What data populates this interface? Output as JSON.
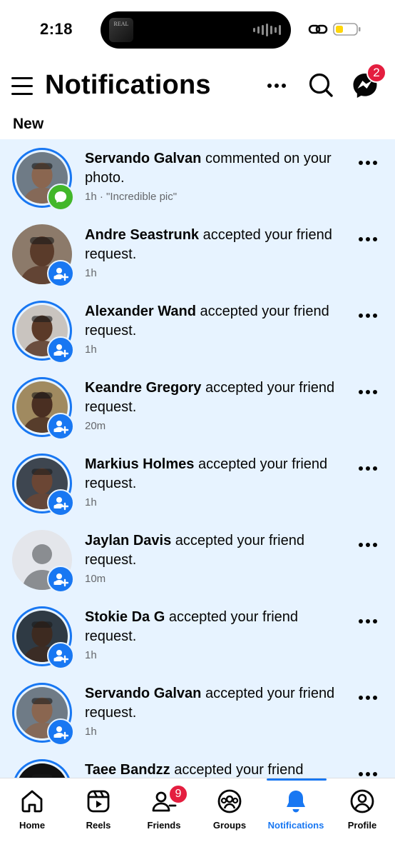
{
  "status_bar": {
    "time": "2:18",
    "album_text": "REAL",
    "battery_color": "#ffd60a"
  },
  "header": {
    "title": "Notifications",
    "messenger_badge": "2",
    "menu_icon": "hamburger-icon",
    "more_icon": "more-horizontal-icon",
    "search_icon": "search-icon",
    "messenger_icon": "messenger-icon"
  },
  "section": {
    "new_label": "New"
  },
  "notifications": [
    {
      "name": "Servando Galvan",
      "action": " commented on your photo.",
      "time": "1h",
      "snippet": "\"Incredible pic\"",
      "type": "comment",
      "ring": true,
      "skin": "#8a6650",
      "bg": "#6f7b86"
    },
    {
      "name": "Andre Seastrunk",
      "action": " accepted your friend request.",
      "time": "1h",
      "snippet": "",
      "type": "friend",
      "ring": false,
      "skin": "#5a3b2a",
      "bg": "#8c7a6a"
    },
    {
      "name": "Alexander Wand",
      "action": " accepted your friend request.",
      "time": "1h",
      "snippet": "",
      "type": "friend",
      "ring": true,
      "skin": "#5b3a28",
      "bg": "#c9c4bf"
    },
    {
      "name": "Keandre Gregory",
      "action": " accepted your friend request.",
      "time": "20m",
      "snippet": "",
      "type": "friend",
      "ring": true,
      "skin": "#4a2f22",
      "bg": "#a08a60"
    },
    {
      "name": "Markius Holmes",
      "action": " accepted your friend request.",
      "time": "1h",
      "snippet": "",
      "type": "friend",
      "ring": true,
      "skin": "#6b4634",
      "bg": "#3e4650"
    },
    {
      "name": "Jaylan Davis",
      "action": " accepted your friend request.",
      "time": "10m",
      "snippet": "",
      "type": "friend",
      "ring": false,
      "skin": "",
      "bg": "#e4e6eb",
      "placeholder": true
    },
    {
      "name": "Stokie Da G",
      "action": " accepted your friend request.",
      "time": "1h",
      "snippet": "",
      "type": "friend",
      "ring": true,
      "skin": "#3d2a20",
      "bg": "#2f3a44"
    },
    {
      "name": "Servando Galvan",
      "action": " accepted your friend request.",
      "time": "1h",
      "snippet": "",
      "type": "friend",
      "ring": true,
      "skin": "#8a6650",
      "bg": "#6f7b86"
    },
    {
      "name": "Taee Bandzz",
      "action": " accepted your friend",
      "time": "",
      "snippet": "",
      "type": "friend",
      "ring": true,
      "skin": "#111111",
      "bg": "#111111"
    }
  ],
  "tabs": [
    {
      "label": "Home",
      "icon": "home-icon",
      "badge": ""
    },
    {
      "label": "Reels",
      "icon": "reels-icon",
      "badge": ""
    },
    {
      "label": "Friends",
      "icon": "friends-icon",
      "badge": "9"
    },
    {
      "label": "Groups",
      "icon": "groups-icon",
      "badge": ""
    },
    {
      "label": "Notifications",
      "icon": "bell-icon",
      "badge": "",
      "active": true
    },
    {
      "label": "Profile",
      "icon": "profile-icon",
      "badge": ""
    }
  ],
  "colors": {
    "accent": "#1877f2",
    "badge_red": "#e41e3f",
    "unread_bg": "#e7f3ff",
    "comment_green": "#42b72a"
  }
}
